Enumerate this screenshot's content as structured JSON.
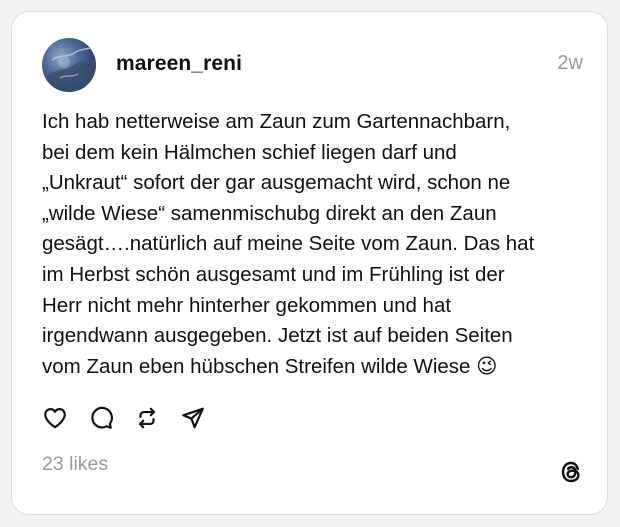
{
  "post": {
    "username": "mareen_reni",
    "time_ago": "2w",
    "text": "Ich hab netterweise am Zaun zum Gartennachbarn,\nbei dem kein Hälmchen schief liegen darf und\n„Unkraut“ sofort der gar ausgemacht wird, schon ne\n„wilde Wiese“ samenmischubg direkt an den Zaun\ngesägt….natürlich auf meine Seite vom Zaun. Das hat\nim Herbst schön ausgesamt und im Frühling ist der\nHerr nicht mehr hinterher gekommen und hat\nirgendwann ausgegeben. Jetzt ist auf beiden Seiten\nvom Zaun eben hübschen Streifen wilde Wiese 😉",
    "likes": "23 likes"
  },
  "icons": {
    "like": "heart-icon",
    "comment": "comment-bubble-icon",
    "repost": "repost-icon",
    "share": "send-icon",
    "brand": "threads-logo-icon"
  },
  "colors": {
    "text": "#111111",
    "muted": "#9a9a9a",
    "card_bg": "#ffffff",
    "page_bg": "#f2f2f2"
  }
}
